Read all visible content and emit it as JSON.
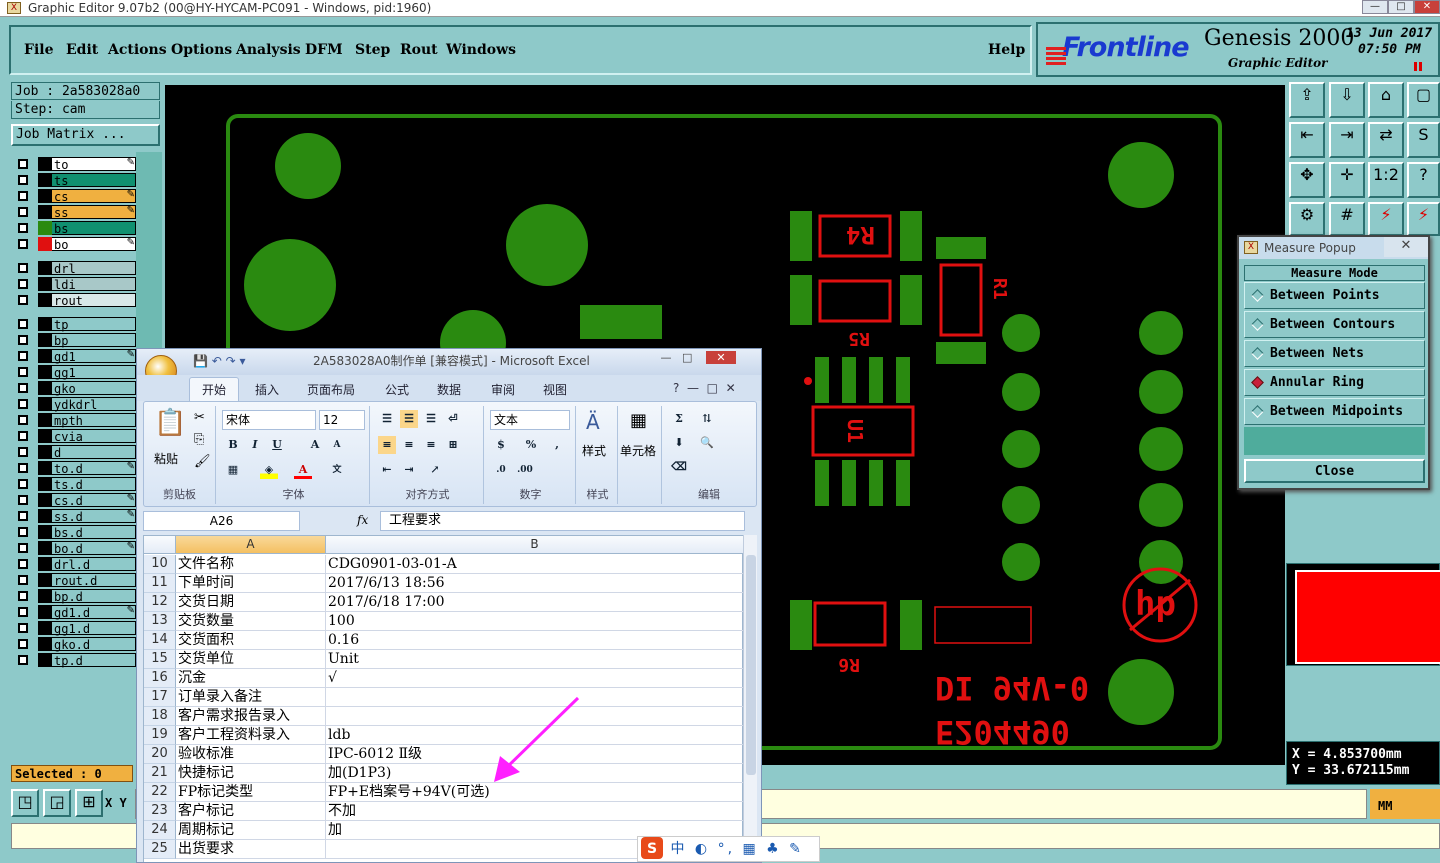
{
  "window": {
    "title": "Graphic Editor 9.07b2 (00@HY-HYCAM-PC091 - Windows, pid:1960)",
    "app_icon": "X"
  },
  "menu": {
    "items": [
      "File",
      "Edit",
      "Actions",
      "Options",
      "Analysis",
      "DFM",
      "Step",
      "Rout",
      "Windows"
    ],
    "help": "Help"
  },
  "brand": {
    "logo": "Frontline",
    "product": "Genesis 2000",
    "subtitle": "Graphic Editor",
    "date": "13 Jun 2017",
    "time": "07:50 PM"
  },
  "job": {
    "job_label": "Job : 2a583028a0",
    "step_label": "Step: cam",
    "matrix_button": "Job Matrix ..."
  },
  "layers": [
    {
      "name": "to",
      "color": "#ffffff",
      "pen": true
    },
    {
      "name": "ts",
      "color": "#109070",
      "pen": false
    },
    {
      "name": "cs",
      "color": "#f0b040",
      "pen": true
    },
    {
      "name": "ss",
      "color": "#f0b040",
      "pen": true
    },
    {
      "name": "bs",
      "color": "#109070",
      "pen": false
    },
    {
      "name": "bo",
      "color": "#ffffff",
      "pen": true
    },
    {
      "name": "drl",
      "color": "#a8c8c8",
      "pen": false
    },
    {
      "name": "ldi",
      "color": "#a8c8c8",
      "pen": false
    },
    {
      "name": "rout",
      "color": "#d8e8e8",
      "pen": false
    },
    {
      "name": "tp",
      "color": "#8ec9c9",
      "pen": false
    },
    {
      "name": "bp",
      "color": "#8ec9c9",
      "pen": false
    },
    {
      "name": "gd1",
      "color": "#8ec9c9",
      "pen": true
    },
    {
      "name": "gg1",
      "color": "#8ec9c9",
      "pen": false
    },
    {
      "name": "gko",
      "color": "#8ec9c9",
      "pen": false
    },
    {
      "name": "ydkdrl",
      "color": "#8ec9c9",
      "pen": false
    },
    {
      "name": "mpth",
      "color": "#8ec9c9",
      "pen": false
    },
    {
      "name": "cvia",
      "color": "#8ec9c9",
      "pen": false
    },
    {
      "name": "d",
      "color": "#8ec9c9",
      "pen": false
    },
    {
      "name": "to.d",
      "color": "#8ec9c9",
      "pen": true
    },
    {
      "name": "ts.d",
      "color": "#8ec9c9",
      "pen": false
    },
    {
      "name": "cs.d",
      "color": "#8ec9c9",
      "pen": true
    },
    {
      "name": "ss.d",
      "color": "#8ec9c9",
      "pen": true
    },
    {
      "name": "bs.d",
      "color": "#8ec9c9",
      "pen": false
    },
    {
      "name": "bo.d",
      "color": "#8ec9c9",
      "pen": true
    },
    {
      "name": "drl.d",
      "color": "#8ec9c9",
      "pen": false
    },
    {
      "name": "rout.d",
      "color": "#8ec9c9",
      "pen": false
    },
    {
      "name": "bp.d",
      "color": "#8ec9c9",
      "pen": false
    },
    {
      "name": "gd1.d",
      "color": "#8ec9c9",
      "pen": true
    },
    {
      "name": "gg1.d",
      "color": "#8ec9c9",
      "pen": false
    },
    {
      "name": "gko.d",
      "color": "#8ec9c9",
      "pen": false
    },
    {
      "name": "tp.d",
      "color": "#8ec9c9",
      "pen": false
    }
  ],
  "selected": "Selected : 0",
  "xy_label": "X Y",
  "unit": "MM",
  "coords": {
    "x": "X = 4.853700mm",
    "y": "Y = 33.672115mm"
  },
  "measure_popup": {
    "title": "Measure Popup",
    "header": "Measure Mode",
    "modes": [
      "Between Points",
      "Between Contours",
      "Between Nets",
      "Annular Ring",
      "Between Midpoints"
    ],
    "selected": "Annular Ring",
    "close": "Close"
  },
  "pcb": {
    "silkscreen": [
      "R4",
      "R1",
      "R5",
      "U1",
      "R6",
      "DI 94V-0",
      "E204490",
      "hp"
    ]
  },
  "excel": {
    "title": "2A583028A0制作单 [兼容模式] - Microsoft Excel",
    "tabs": [
      "开始",
      "插入",
      "页面布局",
      "公式",
      "数据",
      "审阅",
      "视图"
    ],
    "groups": [
      "剪贴板",
      "字体",
      "对齐方式",
      "数字",
      "样式",
      "单元格",
      "编辑"
    ],
    "paste": "粘贴",
    "font_name": "宋体",
    "font_size": "12",
    "number_format": "文本",
    "style_label": "样式",
    "cell_label": "单元格",
    "name_box": "A26",
    "fx": "fx",
    "formula": "工程要求",
    "columns": [
      "A",
      "B"
    ],
    "rows": [
      {
        "n": "10",
        "a": "文件名称",
        "b": "CDG0901-03-01-A"
      },
      {
        "n": "11",
        "a": "下单时间",
        "b": "2017/6/13 18:56"
      },
      {
        "n": "12",
        "a": "交货日期",
        "b": "2017/6/18 17:00"
      },
      {
        "n": "13",
        "a": "交货数量",
        "b": "100"
      },
      {
        "n": "14",
        "a": "交货面积",
        "b": "0.16"
      },
      {
        "n": "15",
        "a": "交货单位",
        "b": "Unit"
      },
      {
        "n": "16",
        "a": "沉金",
        "b": "√"
      },
      {
        "n": "17",
        "a": "订单录入备注",
        "b": ""
      },
      {
        "n": "18",
        "a": "客户需求报告录入",
        "b": ""
      },
      {
        "n": "19",
        "a": "客户工程资料录入",
        "b": "ldb"
      },
      {
        "n": "20",
        "a": "验收标准",
        "b": "IPC-6012 Ⅱ级"
      },
      {
        "n": "21",
        "a": "快捷标记",
        "b": "加(D1P3)"
      },
      {
        "n": "22",
        "a": "FP标记类型",
        "b": "FP+E档案号+94V(可选)"
      },
      {
        "n": "23",
        "a": "客户标记",
        "b": "不加"
      },
      {
        "n": "24",
        "a": "周期标记",
        "b": "加"
      },
      {
        "n": "25",
        "a": "出货要求",
        "b": ""
      }
    ]
  },
  "ime": {
    "text": "中 ◐ °, ▦ ♣ ✎"
  },
  "colors": {
    "panel": "#8ec9c9",
    "pcb_green": "#2a8a10",
    "pcb_red": "#e01010",
    "arrow": "#ff20ff"
  }
}
